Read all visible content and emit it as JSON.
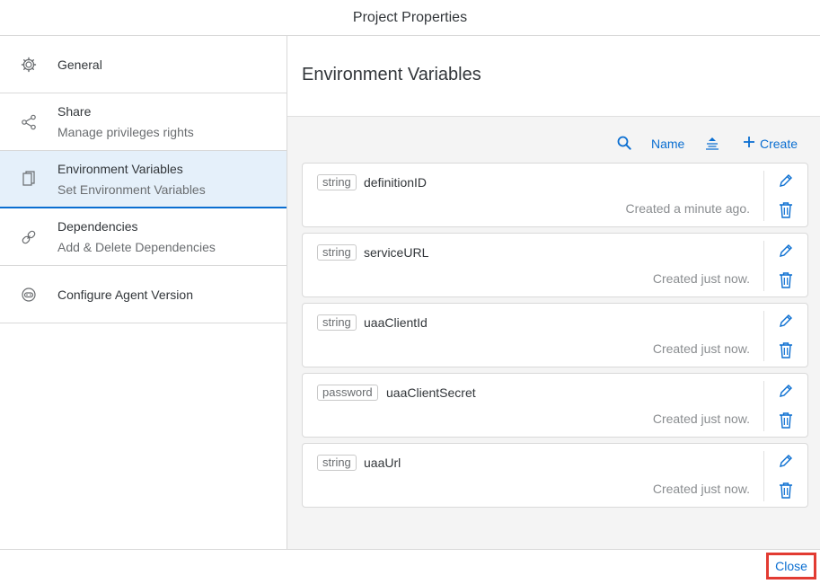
{
  "window": {
    "title": "Project Properties"
  },
  "sidebar": {
    "items": [
      {
        "title": "General",
        "subtitle": "",
        "icon": "gear-icon"
      },
      {
        "title": "Share",
        "subtitle": "Manage privileges rights",
        "icon": "share-icon"
      },
      {
        "title": "Environment Variables",
        "subtitle": "Set Environment Variables",
        "icon": "document-icon",
        "selected": true
      },
      {
        "title": "Dependencies",
        "subtitle": "Add & Delete Dependencies",
        "icon": "link-icon"
      },
      {
        "title": "Configure Agent Version",
        "subtitle": "",
        "icon": "robot-icon"
      }
    ]
  },
  "main": {
    "title": "Environment Variables",
    "toolbar": {
      "sort_label": "Name",
      "create_label": "Create"
    },
    "variables": [
      {
        "type": "string",
        "name": "definitionID",
        "created": "Created a minute ago."
      },
      {
        "type": "string",
        "name": "serviceURL",
        "created": "Created just now."
      },
      {
        "type": "string",
        "name": "uaaClientId",
        "created": "Created just now."
      },
      {
        "type": "password",
        "name": "uaaClientSecret",
        "created": "Created just now."
      },
      {
        "type": "string",
        "name": "uaaUrl",
        "created": "Created just now."
      }
    ]
  },
  "footer": {
    "close_label": "Close"
  },
  "colors": {
    "accent": "#0a6ed1",
    "selected_bg": "#e5f0fa",
    "highlight": "#e23b32"
  }
}
